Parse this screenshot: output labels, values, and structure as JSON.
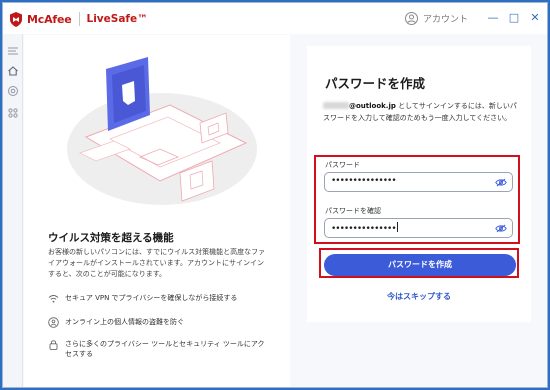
{
  "titlebar": {
    "brand_name": "McAfee",
    "product_name": "LiveSafe™",
    "account_label": "アカウント",
    "minimize": "—",
    "maximize": "□",
    "close": "✕"
  },
  "sidebar": {
    "items": [
      "menu-icon",
      "home-icon",
      "protection-icon",
      "apps-icon"
    ]
  },
  "left_panel": {
    "title": "ウイルス対策を超える機能",
    "description": "お客様の新しいパソコンには、すでにウイルス対策機能と高度なファイアウォールがインストールされています。アカウントにサインインすると、次のことが可能になります。",
    "features": [
      {
        "icon": "wifi-icon",
        "text": "セキュア VPN でプライバシーを確保しながら接続する"
      },
      {
        "icon": "identity-shield-icon",
        "text": "オンライン上の個人情報の盗難を防ぐ"
      },
      {
        "icon": "lock-icon",
        "text": "さらに多くのプライバシー ツールとセキュリティ ツールにアクセスする"
      }
    ]
  },
  "form": {
    "title": "パスワードを作成",
    "email_suffix": "@outlook.jp",
    "description_lead": " としてサインインするには、新しいパスワードを入力して確認のためもう一度入力してください。",
    "password_label": "パスワード",
    "password_value": "•••••••••••••••",
    "confirm_label": "パスワードを確認",
    "confirm_value": "•••••••••••••••",
    "create_button": "パスワードを作成",
    "skip_link": "今はスキップする"
  },
  "colors": {
    "brand_red": "#c01818",
    "accent_blue": "#3b5bd9",
    "highlight_red": "#d0101c"
  }
}
